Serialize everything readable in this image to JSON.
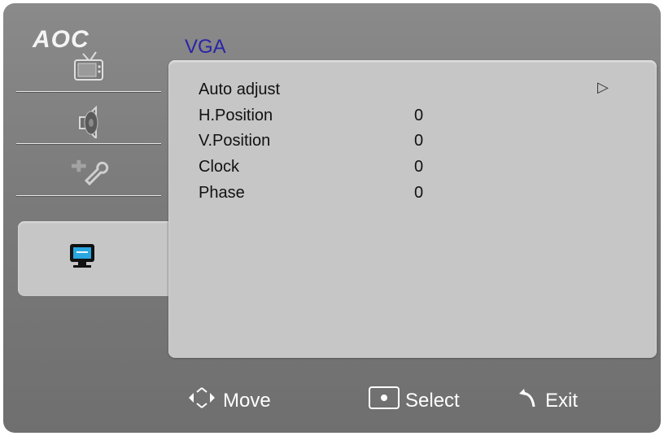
{
  "brand": {
    "logo": "AOC"
  },
  "header": {
    "title": "VGA"
  },
  "nav": {
    "items": [
      {
        "icon": "picture-icon"
      },
      {
        "icon": "speaker-icon"
      },
      {
        "icon": "tools-icon"
      },
      {
        "icon": "display-icon",
        "selected": true
      }
    ]
  },
  "menu": {
    "rows": [
      {
        "label": "Auto adjust",
        "value": "",
        "arrow": "▷"
      },
      {
        "label": "H.Position",
        "value": "0"
      },
      {
        "label": "V.Position",
        "value": "0"
      },
      {
        "label": "Clock",
        "value": "0"
      },
      {
        "label": "Phase",
        "value": "0"
      }
    ]
  },
  "footer": {
    "move_label": "Move",
    "select_label": "Select",
    "exit_label": "Exit"
  }
}
